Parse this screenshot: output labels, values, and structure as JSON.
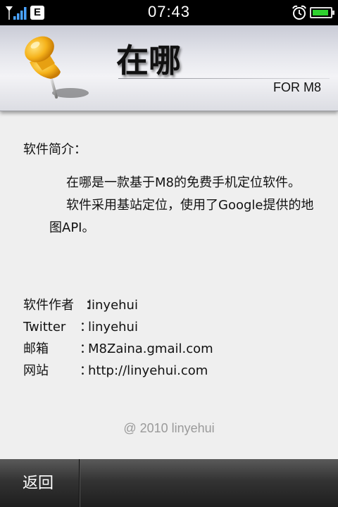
{
  "status_bar": {
    "time": "07:43",
    "network_type": "E",
    "icons": [
      "signal-icon",
      "network-e-icon",
      "alarm-icon",
      "battery-icon"
    ],
    "battery_level": 0.9,
    "battery_color": "#2fd22f"
  },
  "header": {
    "title": "在哪",
    "subtitle": "FOR M8",
    "logo_icon": "pushpin-icon"
  },
  "intro": {
    "heading": "软件简介：",
    "lines": [
      "在哪是一款基于M8的免费手机定位软件。",
      "软件采用基站定位，使用了Google提供的地图API。"
    ]
  },
  "info": {
    "author": {
      "label": "软件作者",
      "sep": "：",
      "value": "linyehui"
    },
    "twitter": {
      "label": "Twitter",
      "sep": "：",
      "value": "linyehui"
    },
    "email": {
      "label": "邮箱",
      "sep": "：",
      "value": "M8Zaina.gmail.com"
    },
    "website": {
      "label": "网站",
      "sep": "：",
      "value": "http://linyehui.com"
    }
  },
  "copyright": "@ 2010 linyehui",
  "bottom_bar": {
    "back_label": "返回"
  }
}
